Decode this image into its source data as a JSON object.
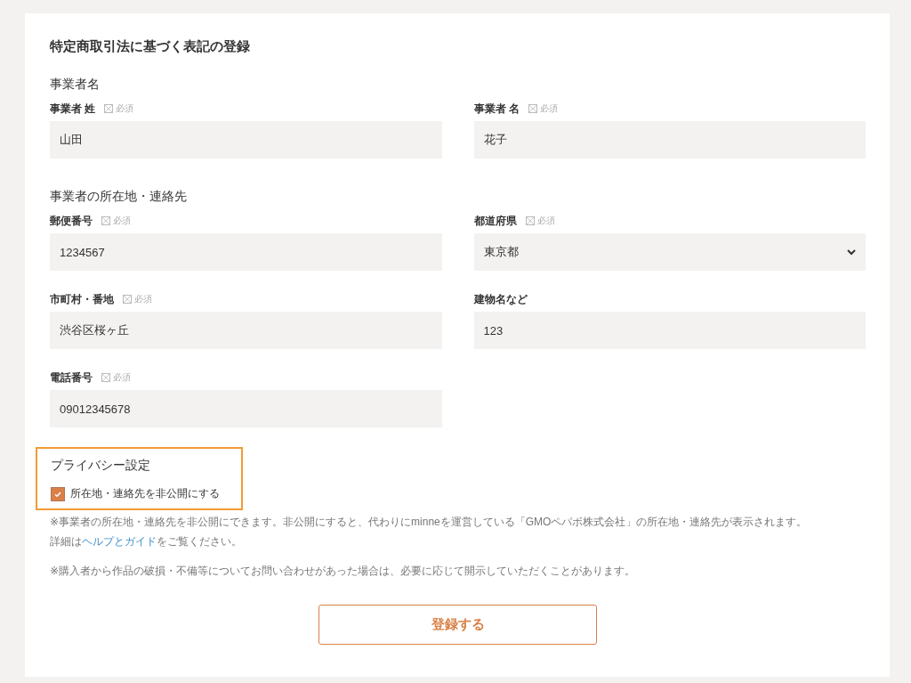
{
  "title": "特定商取引法に基づく表記の登録",
  "sections": [
    {
      "heading": "事業者名",
      "fields": [
        {
          "label": "事業者 姓",
          "required_label": "必須",
          "kind": "text",
          "value": "山田"
        },
        {
          "label": "事業者 名",
          "required_label": "必須",
          "kind": "text",
          "value": "花子"
        }
      ]
    },
    {
      "heading": "事業者の所在地・連絡先",
      "fields": [
        {
          "label": "郵便番号",
          "required_label": "必須",
          "kind": "text",
          "value": "1234567"
        },
        {
          "label": "都道府県",
          "required_label": "必須",
          "kind": "select",
          "value": "東京都"
        },
        {
          "label": "市町村・番地",
          "required_label": "必須",
          "kind": "text",
          "value": "渋谷区桜ヶ丘"
        },
        {
          "label": "建物名など",
          "kind": "text",
          "value": "123"
        },
        {
          "label": "電話番号",
          "required_label": "必須",
          "kind": "text",
          "value": "09012345678"
        }
      ]
    }
  ],
  "privacy": {
    "heading": "プライバシー設定",
    "highlighted": true,
    "checkbox": {
      "label": "所在地・連絡先を非公開にする",
      "checked": true
    }
  },
  "notes": [
    {
      "text": "※事業者の所在地・連絡先を非公開にできます。非公開にすると、代わりにminneを運営している「GMOペパボ株式会社」の所在地・連絡先が表示されます。",
      "detail_prefix": "詳細は",
      "link": "ヘルプとガイド",
      "detail_suffix": "をご覧ください。"
    },
    {
      "text": "※購入者から作品の破損・不備等についてお問い合わせがあった場合は、必要に応じて開示していただくことがあります。"
    }
  ],
  "submit": "登録する"
}
